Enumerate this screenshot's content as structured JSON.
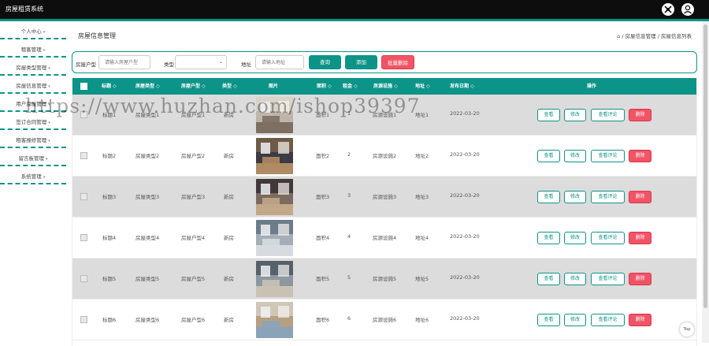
{
  "app": {
    "title": "房屋租赁系统"
  },
  "colors": {
    "accent": "#0d9488",
    "danger": "#f25467",
    "header_bg": "#0d0d0d"
  },
  "header_icons": [
    "fullscreen-icon",
    "user-icon"
  ],
  "sidebar": {
    "items": [
      {
        "label": "个人中心"
      },
      {
        "label": "租客管理"
      },
      {
        "label": "房屋类型管理"
      },
      {
        "label": "房屋信息管理"
      },
      {
        "label": "用户房屋管理"
      },
      {
        "label": "签订合同管理"
      },
      {
        "label": "租客报修管理"
      },
      {
        "label": "留言板管理"
      },
      {
        "label": "系统管理"
      }
    ]
  },
  "page": {
    "title": "房屋信息管理",
    "breadcrumb": {
      "home_icon": "home-icon",
      "level1": "房屋信息管理",
      "separator": "/",
      "level2": "房屋信息列表"
    }
  },
  "search": {
    "huxing_label": "房屋户型",
    "huxing_placeholder": "请输入房屋户型",
    "type_label": "类型",
    "type_value": "",
    "address_label": "地址",
    "address_placeholder": "请输入地址",
    "query_button": "查询",
    "add_button": "添加",
    "batch_delete_button": "批量删除"
  },
  "table": {
    "headers": [
      "标题",
      "房屋类型",
      "房屋户型",
      "类型",
      "图片",
      "面积",
      "租金",
      "房源设施",
      "地址",
      "发布日期",
      "操作"
    ],
    "rows": [
      {
        "title": "标题1",
        "house_type": "房屋类型1",
        "huxing": "房屋户型1",
        "kind": "新房",
        "area": "面积1",
        "rent": "1",
        "facility": "房源设施1",
        "address": "地址1",
        "date": "2022-03-20"
      },
      {
        "title": "标题2",
        "house_type": "房屋类型2",
        "huxing": "房屋户型2",
        "kind": "新房",
        "area": "面积2",
        "rent": "2",
        "facility": "房源设施2",
        "address": "地址2",
        "date": "2022-03-20"
      },
      {
        "title": "标题3",
        "house_type": "房屋类型3",
        "huxing": "房屋户型3",
        "kind": "新房",
        "area": "面积3",
        "rent": "3",
        "facility": "房源设施3",
        "address": "地址3",
        "date": "2022-03-20"
      },
      {
        "title": "标题4",
        "house_type": "房屋类型4",
        "huxing": "房屋户型4",
        "kind": "新房",
        "area": "面积4",
        "rent": "4",
        "facility": "房源设施4",
        "address": "地址4",
        "date": "2022-03-20"
      },
      {
        "title": "标题5",
        "house_type": "房屋类型5",
        "huxing": "房屋户型5",
        "kind": "新房",
        "area": "面积5",
        "rent": "5",
        "facility": "房源设施5",
        "address": "地址5",
        "date": "2022-03-20"
      },
      {
        "title": "标题6",
        "house_type": "房屋类型6",
        "huxing": "房屋户型6",
        "kind": "新房",
        "area": "面积6",
        "rent": "6",
        "facility": "房源设施6",
        "address": "地址6",
        "date": "2022-03-20"
      }
    ],
    "actions": {
      "view": "查看",
      "edit": "修改",
      "view_comments": "查看评论",
      "delete": "删除"
    }
  },
  "watermark": "https://www.huzhan.com/ishop39397",
  "back_to_top": "Top"
}
